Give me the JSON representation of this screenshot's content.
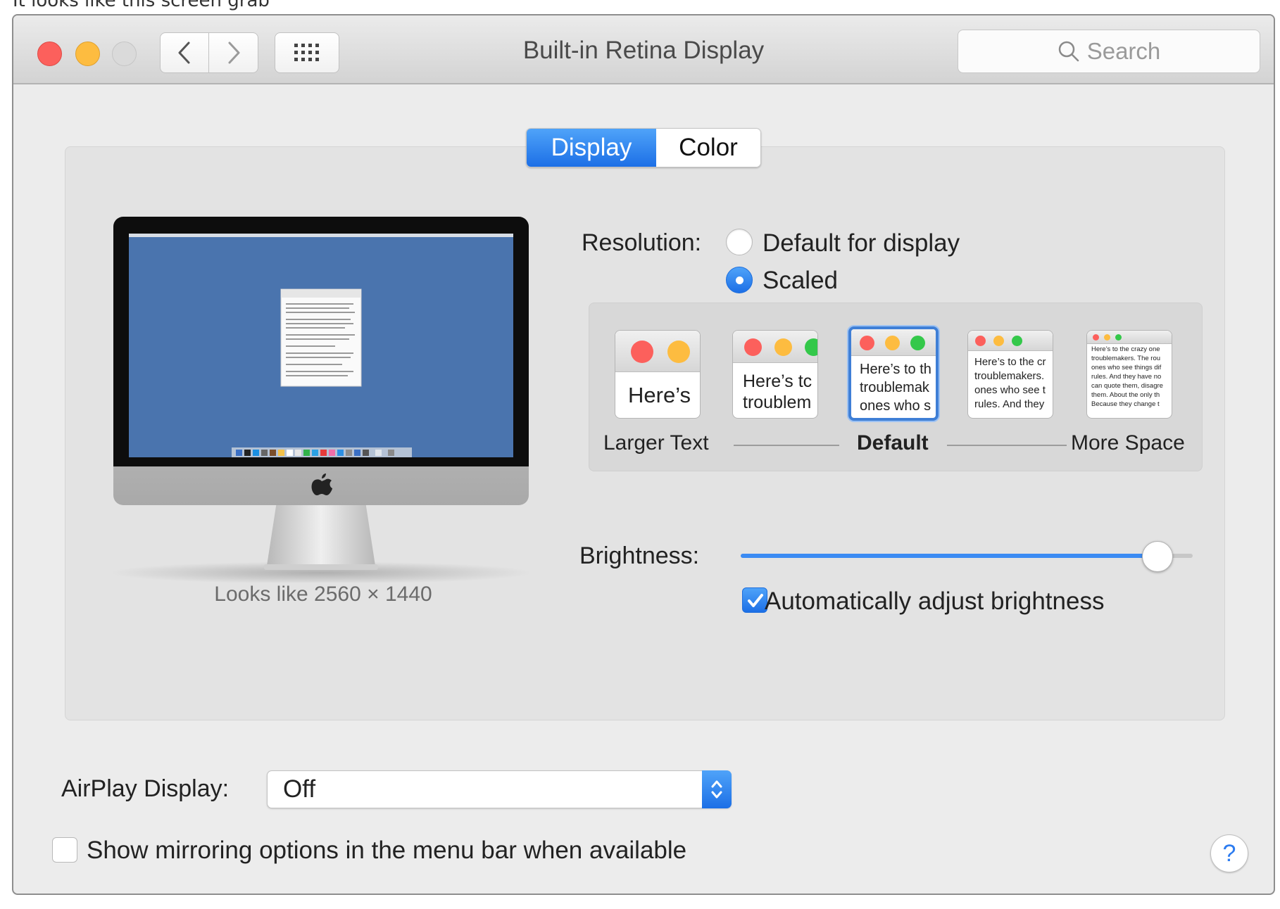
{
  "caption": "It looks like this screen grab",
  "window": {
    "title": "Built-in Retina Display"
  },
  "toolbar": {
    "search_placeholder": "Search"
  },
  "tabs": [
    {
      "label": "Display",
      "active": true
    },
    {
      "label": "Color",
      "active": false
    }
  ],
  "preview": {
    "looks_like": "Looks like 2560 × 1440"
  },
  "resolution": {
    "label": "Resolution:",
    "options": [
      {
        "label": "Default for display",
        "selected": false
      },
      {
        "label": "Scaled",
        "selected": true
      }
    ]
  },
  "scaling": {
    "thumb_texts": {
      "t1": "Here’s",
      "t2a": "Here’s tc",
      "t2b": "troublem",
      "t3a": "Here’s to th",
      "t3b": "troublemak",
      "t3c": "ones who s",
      "t4a": "Here’s to the cr",
      "t4b": "troublemakers.",
      "t4c": "ones who see t",
      "t4d": "rules. And they",
      "t5a": "Here’s to the crazy one",
      "t5b": "troublemakers. The rou",
      "t5c": "ones who see things dif",
      "t5d": "rules. And they have no",
      "t5e": "can quote them, disagre",
      "t5f": "them. About the only th",
      "t5g": "Because they change t"
    },
    "labels": {
      "left": "Larger Text",
      "middle": "Default",
      "right": "More Space"
    },
    "selected_index": 2
  },
  "brightness": {
    "label": "Brightness:",
    "level": 0.92
  },
  "auto_brightness": {
    "label": "Automatically adjust brightness",
    "checked": true
  },
  "airplay": {
    "label": "AirPlay Display:",
    "value": "Off"
  },
  "mirroring": {
    "label": "Show mirroring options in the menu bar when available",
    "checked": false
  },
  "help": {
    "glyph": "?"
  },
  "colors": {
    "accent": "#1c6fe6",
    "traffic_red": "#fc605c",
    "traffic_yellow": "#fdbc40",
    "traffic_green": "#34c84a"
  }
}
